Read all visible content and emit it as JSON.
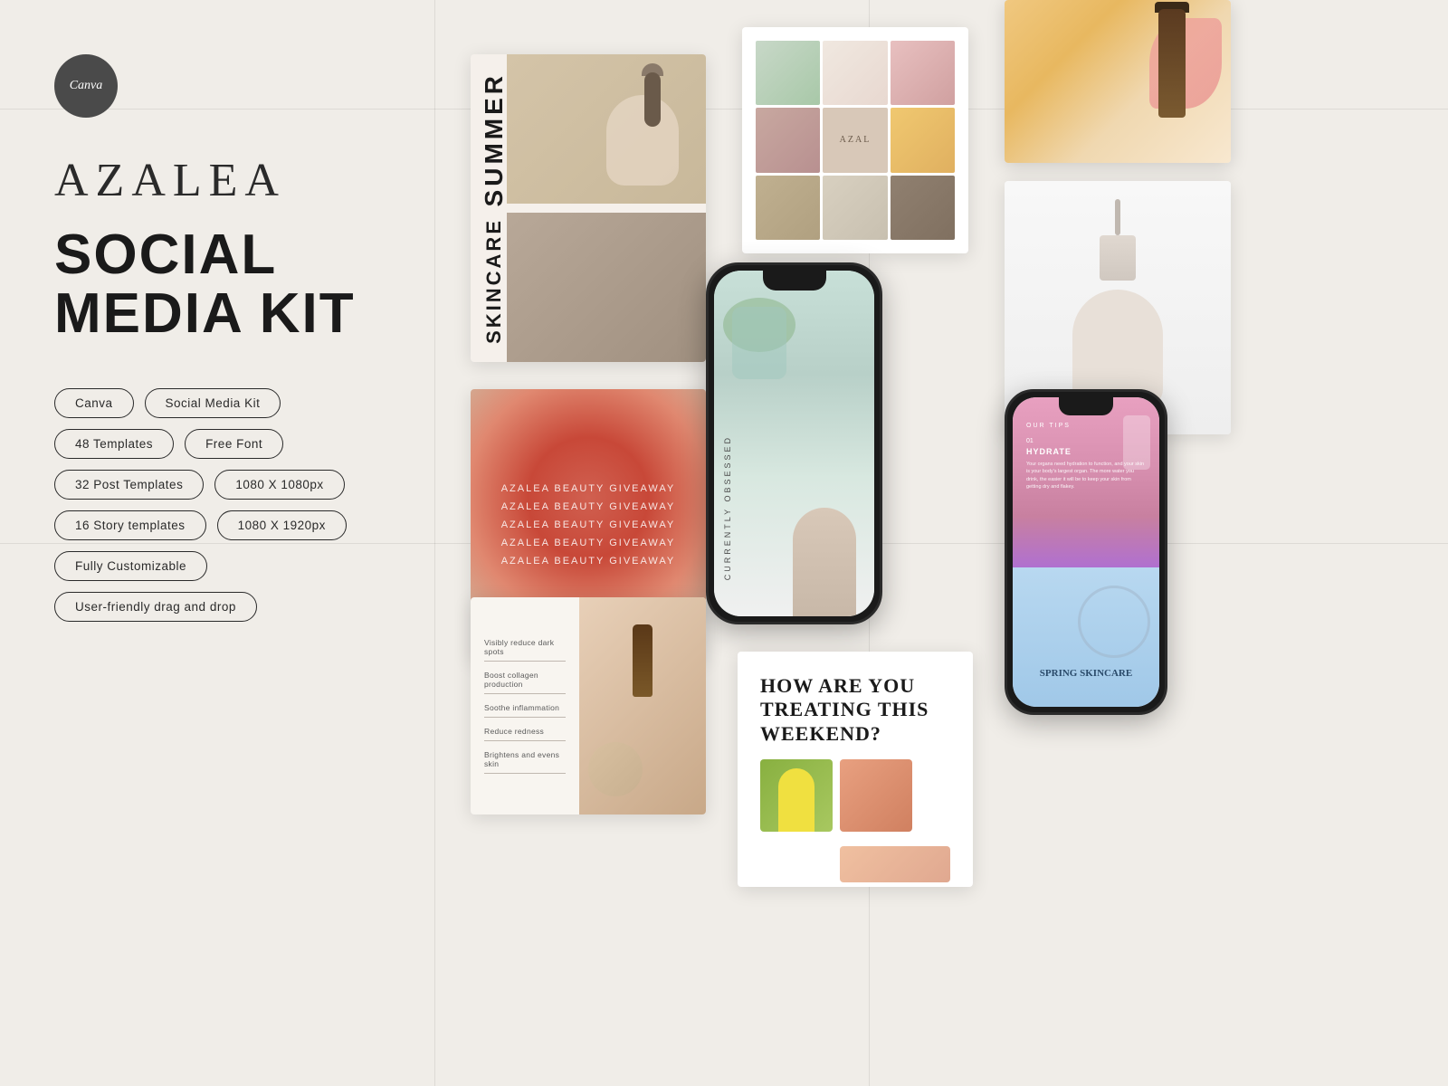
{
  "brand": {
    "name": "AZALEA",
    "canva_label": "Canva"
  },
  "product": {
    "title_line1": "SOCIAL",
    "title_line2": "MEDIA KIT"
  },
  "tags": [
    "Canva",
    "Social Media Kit",
    "48 Templates",
    "Free Font",
    "32 Post Templates",
    "1080 X 1080px",
    "16 Story templates",
    "1080 X 1920px",
    "Fully Customizable",
    "User-friendly drag and drop"
  ],
  "cards": {
    "summer": {
      "label1": "SUMMER",
      "label2": "SKINCARE"
    },
    "mosaic": {
      "center_text": "AZAL"
    },
    "giveaway": {
      "lines": [
        "AZALEA BEAUTY GIVEAWAY",
        "AZALEA BEAUTY GIVEAWAY",
        "AZALEA BEAUTY GIVEAWAY",
        "AZALEA BEAUTY GIVEAWAY",
        "AZALEA BEAUTY GIVEAWAY"
      ]
    },
    "phone1": {
      "vertical_text": "CURRENTLY OBSESSED"
    },
    "serum": {
      "benefits": [
        "Visibly reduce dark spots",
        "Boost collagen production",
        "Soothe inflammation",
        "Reduce redness",
        "Brightens and evens skin"
      ]
    },
    "how": {
      "headline": "HOW ARE YOU TREATING THIS WEEKEND?"
    },
    "phone2": {
      "tips_label": "OUR TIPS",
      "num": "01",
      "hydrate": "HYDRATE",
      "desc": "Your organs need hydration to function, and your skin is your body's largest organ. The more water you drink, the easier it will be to keep your skin from getting dry and flakey.",
      "spring_label": "SPRING SKINCARE"
    }
  },
  "colors": {
    "background": "#f0ede8",
    "text_dark": "#1a1a1a",
    "text_medium": "#2a2a2a",
    "badge_bg": "#4a4a4a",
    "accent_warm": "#d06050"
  }
}
